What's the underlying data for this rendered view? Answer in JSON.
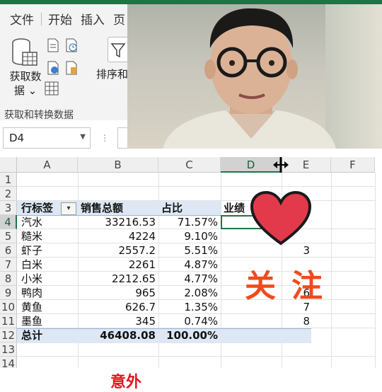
{
  "ribbon": {
    "tabs": [
      "文件",
      "开始",
      "插入",
      "页"
    ],
    "get_data_label": "获取数据",
    "get_data_sub": "据",
    "get_data_prefix": "获取数",
    "sort_label": "排序和",
    "group_label": "获取和转换数据"
  },
  "formula_bar": {
    "name_box": "D4",
    "dots": "⋮"
  },
  "columns": [
    "A",
    "B",
    "C",
    "D",
    "E",
    "F"
  ],
  "rows": [
    "1",
    "2",
    "3",
    "4",
    "5",
    "6",
    "7",
    "8",
    "9",
    "10",
    "11",
    "12",
    "13",
    "14"
  ],
  "pivot": {
    "headers": {
      "row_label": "行标签",
      "sales": "销售总额",
      "ratio": "占比",
      "extra": "业绩"
    },
    "items": [
      {
        "name": "汽水",
        "sales": "33216.53",
        "ratio": "71.57%"
      },
      {
        "name": "糙米",
        "sales": "4224",
        "ratio": "9.10%"
      },
      {
        "name": "虾子",
        "sales": "2557.2",
        "ratio": "5.51%"
      },
      {
        "name": "白米",
        "sales": "2261",
        "ratio": "4.87%"
      },
      {
        "name": "小米",
        "sales": "2212.65",
        "ratio": "4.77%"
      },
      {
        "name": "鸭肉",
        "sales": "965",
        "ratio": "2.08%"
      },
      {
        "name": "黄鱼",
        "sales": "626.7",
        "ratio": "1.35%"
      },
      {
        "name": "墨鱼",
        "sales": "345",
        "ratio": "0.74%"
      }
    ],
    "total": {
      "name": "总计",
      "sales": "46408.08",
      "ratio": "100.00%"
    }
  },
  "col_e_values": [
    "3",
    "6",
    "7",
    "8"
  ],
  "overlay": {
    "follow_text": "关注",
    "bottom_text": "意外"
  },
  "colors": {
    "excel_green": "#217346",
    "heart_red": "#e23a4b",
    "follow_orange": "#ef4b1d"
  }
}
